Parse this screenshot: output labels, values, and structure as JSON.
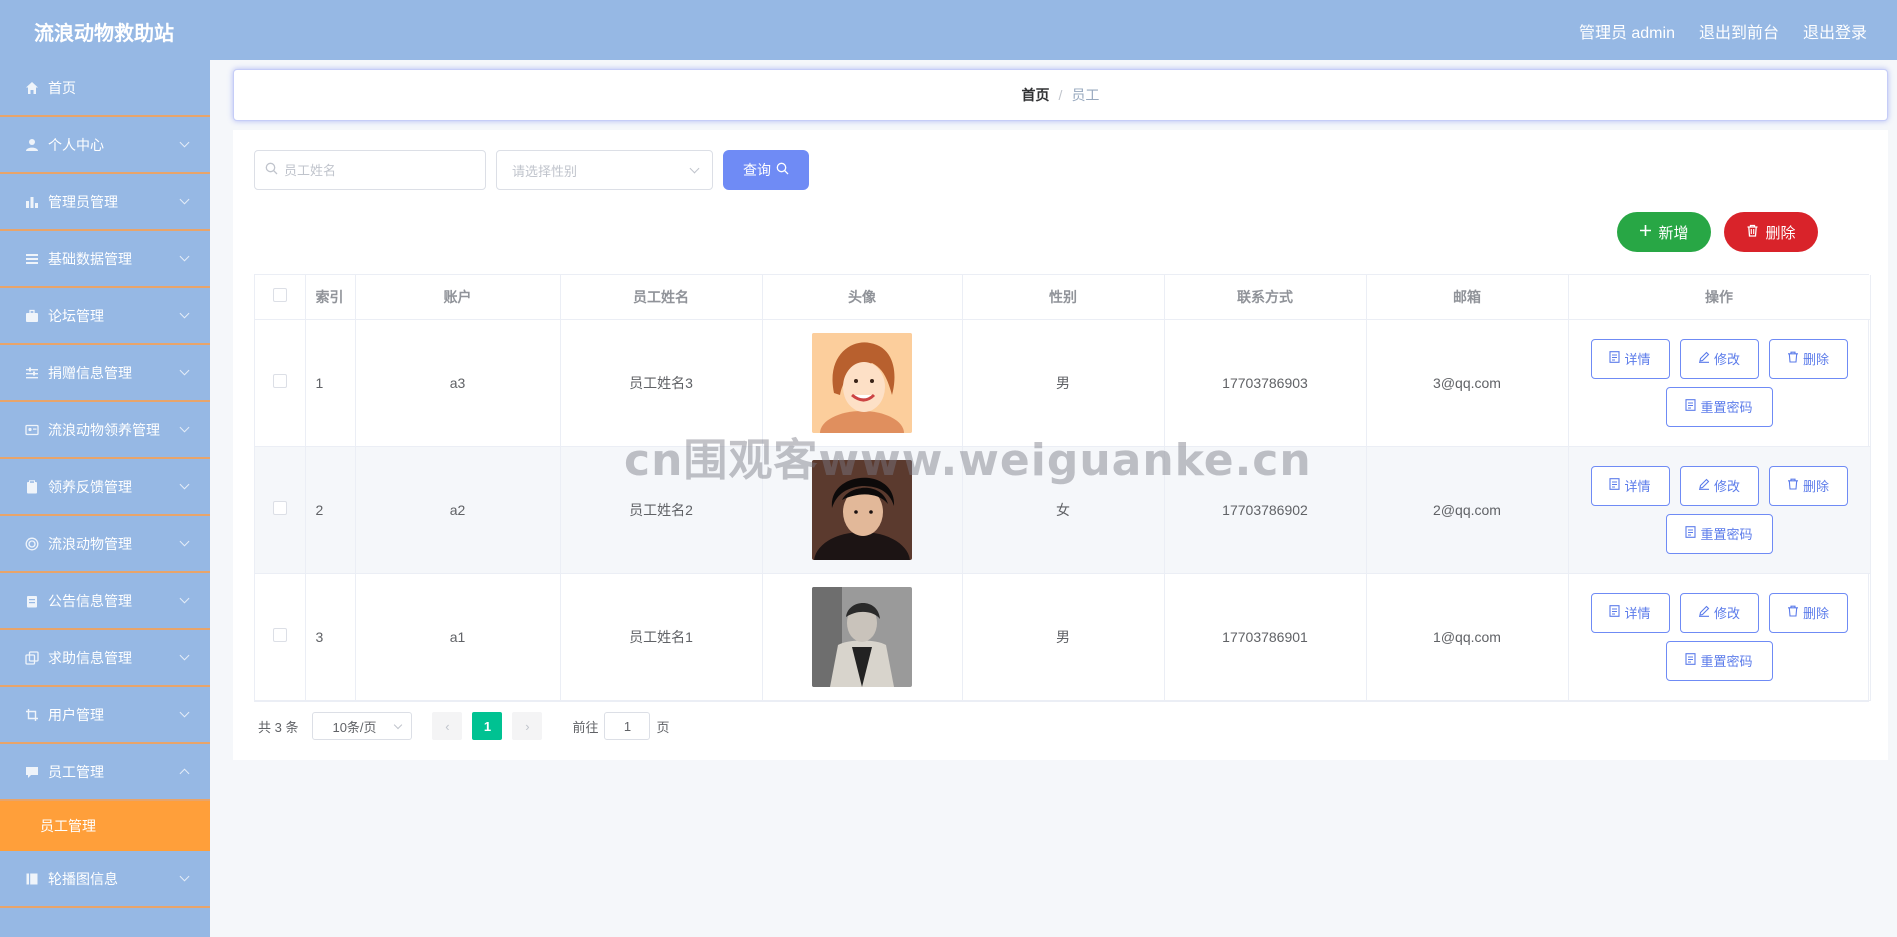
{
  "app": {
    "title": "流浪动物救助站"
  },
  "topbar": {
    "links": [
      "管理员 admin",
      "退出到前台",
      "退出登录"
    ]
  },
  "sidebar": {
    "items": [
      {
        "label": "首页",
        "icon": "home-icon",
        "chevron": false
      },
      {
        "label": "个人中心",
        "icon": "user-icon",
        "chevron": true
      },
      {
        "label": "管理员管理",
        "icon": "bar-chart-icon",
        "chevron": true
      },
      {
        "label": "基础数据管理",
        "icon": "list-icon",
        "chevron": true
      },
      {
        "label": "论坛管理",
        "icon": "briefcase-icon",
        "chevron": true
      },
      {
        "label": "捐赠信息管理",
        "icon": "sliders-icon",
        "chevron": true
      },
      {
        "label": "流浪动物领养管理",
        "icon": "id-card-icon",
        "chevron": true
      },
      {
        "label": "领养反馈管理",
        "icon": "clipboard-icon",
        "chevron": true
      },
      {
        "label": "流浪动物管理",
        "icon": "target-icon",
        "chevron": true
      },
      {
        "label": "公告信息管理",
        "icon": "notice-icon",
        "chevron": true
      },
      {
        "label": "求助信息管理",
        "icon": "copy-icon",
        "chevron": true
      },
      {
        "label": "用户管理",
        "icon": "crop-icon",
        "chevron": true
      },
      {
        "label": "员工管理",
        "icon": "chat-icon",
        "chevron": true
      }
    ],
    "submenu_active": "员工管理",
    "after_items": [
      {
        "label": "轮播图信息",
        "icon": "book-icon",
        "chevron": true
      }
    ]
  },
  "breadcrumb": {
    "home": "首页",
    "separator": "/",
    "current": "员工"
  },
  "search": {
    "name_placeholder": "员工姓名",
    "gender_placeholder": "请选择性别",
    "query_label": "查询"
  },
  "actions": {
    "add_label": "新增",
    "delete_label": "删除"
  },
  "table": {
    "columns": [
      "索引",
      "账户",
      "员工姓名",
      "头像",
      "性别",
      "联系方式",
      "邮箱",
      "操作"
    ],
    "rows": [
      {
        "index": "1",
        "account": "a3",
        "name": "员工姓名3",
        "gender": "男",
        "phone": "17703786903",
        "email": "3@qq.com",
        "avatar": "avatar-3"
      },
      {
        "index": "2",
        "account": "a2",
        "name": "员工姓名2",
        "gender": "女",
        "phone": "17703786902",
        "email": "2@qq.com",
        "avatar": "avatar-2"
      },
      {
        "index": "3",
        "account": "a1",
        "name": "员工姓名1",
        "gender": "男",
        "phone": "17703786901",
        "email": "1@qq.com",
        "avatar": "avatar-1"
      }
    ],
    "row_actions": {
      "detail": "详情",
      "edit": "修改",
      "delete": "删除",
      "reset": "重置密码"
    }
  },
  "pagination": {
    "total_text": "共 3 条",
    "page_size": "10条/页",
    "current_page": "1",
    "goto_prefix": "前往",
    "goto_value": "1",
    "goto_suffix": "页"
  },
  "watermark": "cn围观客www.weiguanke.cn",
  "colors": {
    "topbar": "#96b8e4",
    "sidebar": "#96b8e4",
    "sidebar_divider": "#e8a46a",
    "submenu_active": "#ff9f3a",
    "primary": "#6f8bf5",
    "add": "#28a745",
    "danger": "#d9232a",
    "page_active": "#00c292"
  }
}
